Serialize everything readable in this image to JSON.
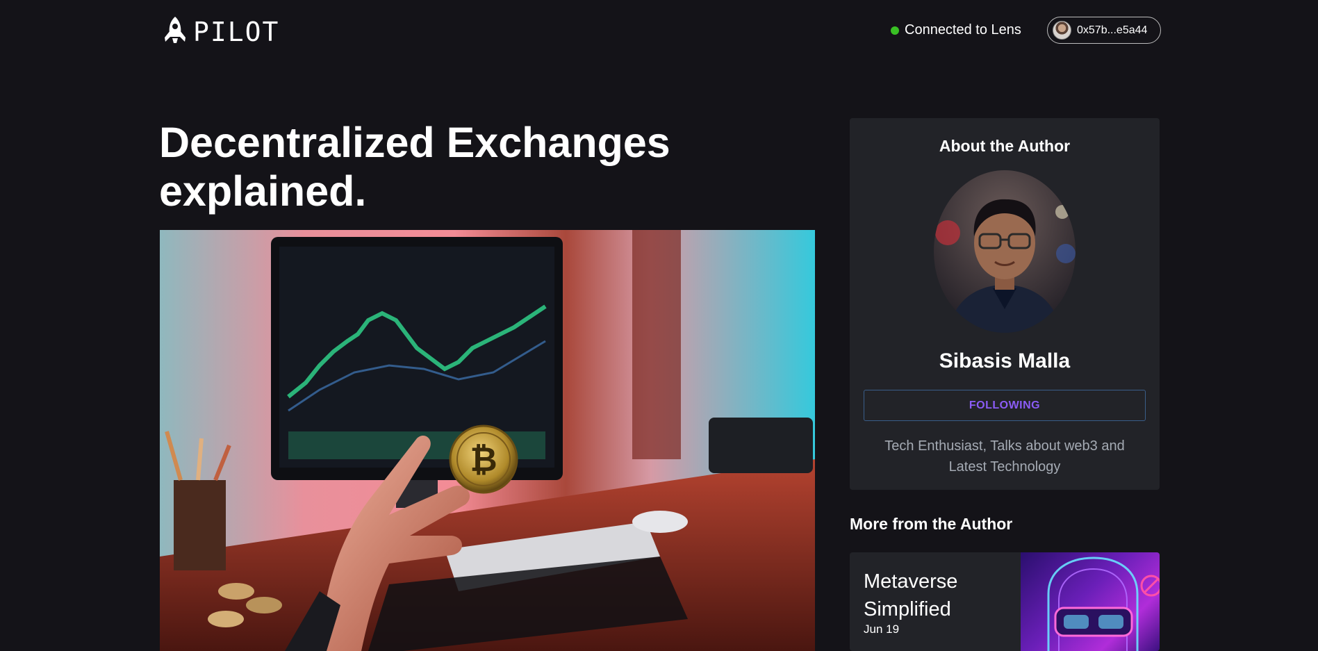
{
  "header": {
    "logo_text": "PILOT",
    "connection_status": "Connected to Lens",
    "wallet_address": "0x57b...e5a44"
  },
  "article": {
    "title": "Decentralized Exchanges explained."
  },
  "author_card": {
    "heading": "About the Author",
    "name": "Sibasis Malla",
    "follow_label": "FOLLOWING",
    "bio": "Tech Enthusiast, Talks about web3 and Latest Technology"
  },
  "more_from_author": {
    "heading": "More from the Author",
    "posts": [
      {
        "title": "Metaverse Simplified",
        "date": "Jun 19"
      }
    ]
  },
  "colors": {
    "background": "#141318",
    "card": "#222328",
    "status_green": "#39c024",
    "accent_purple": "#8b5cf6",
    "muted_text": "#a5abb4"
  }
}
